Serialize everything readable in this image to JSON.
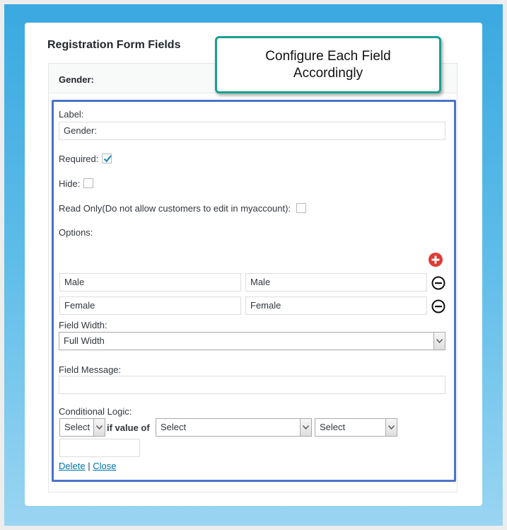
{
  "panel": {
    "title": "Registration Form Fields"
  },
  "field_header": {
    "label": "Gender:"
  },
  "callout": {
    "line1": "Configure Each Field",
    "line2": "Accordingly"
  },
  "form": {
    "label_caption": "Label:",
    "label_value": "Gender:",
    "required_caption": "Required:",
    "required_checked": true,
    "hide_caption": "Hide:",
    "hide_checked": false,
    "readonly_caption": "Read Only(Do not allow customers to edit in myaccount):",
    "readonly_checked": false,
    "options_caption": "Options:",
    "options": [
      {
        "value": "Male",
        "label": "Male"
      },
      {
        "value": "Female",
        "label": "Female"
      }
    ],
    "field_width_caption": "Field Width:",
    "field_width_value": "Full Width",
    "field_message_caption": "Field Message:",
    "field_message_value": "",
    "conditional_caption": "Conditional Logic:",
    "cond_select1": "Select",
    "cond_if_value_of": "if value of",
    "cond_select2": "Select",
    "cond_select3": "Select",
    "cond_value": "",
    "delete_link": "Delete",
    "separator": "|",
    "close_link": "Close"
  },
  "icons": {
    "add": "plus-circle-icon",
    "remove": "minus-circle-icon",
    "dropdown": "chevron-down-icon",
    "check": "checkmark-icon"
  },
  "colors": {
    "background_top": "#3aa9e0",
    "background_bottom": "#9ad5f2",
    "callout_border": "#18a08f",
    "highlight_border": "#4a73c9",
    "add_icon": "#dd3d36",
    "link": "#0073aa"
  }
}
